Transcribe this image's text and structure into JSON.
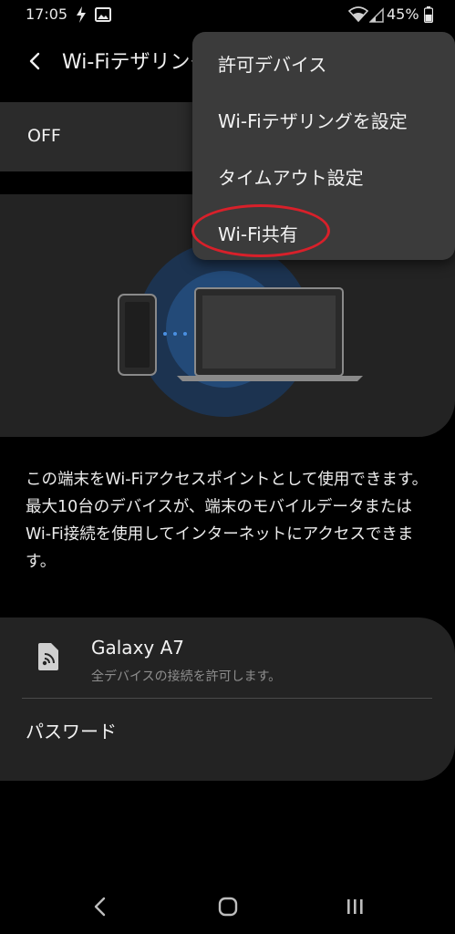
{
  "status": {
    "time": "17:05",
    "battery": "45%"
  },
  "appbar": {
    "title": "Wi-Fiテザリング"
  },
  "toggle": {
    "label": "OFF"
  },
  "description": "この端末をWi-Fiアクセスポイントとして使用できます。最大10台のデバイスが、端末のモバイルデータまたはWi-Fi接続を使用してインターネットにアクセスできます。",
  "network": {
    "name": "Galaxy A7",
    "subtitle": "全デバイスの接続を許可します。",
    "password_label": "パスワード"
  },
  "menu": {
    "items": [
      {
        "label": "許可デバイス"
      },
      {
        "label": "Wi-Fiテザリングを設定"
      },
      {
        "label": "タイムアウト設定"
      },
      {
        "label": "Wi-Fi共有"
      }
    ]
  },
  "colors": {
    "background": "#000000",
    "card": "#232323",
    "menu": "#3b3b3b",
    "highlight": "#d8202a",
    "accent_blue": "#2f7fd6"
  }
}
